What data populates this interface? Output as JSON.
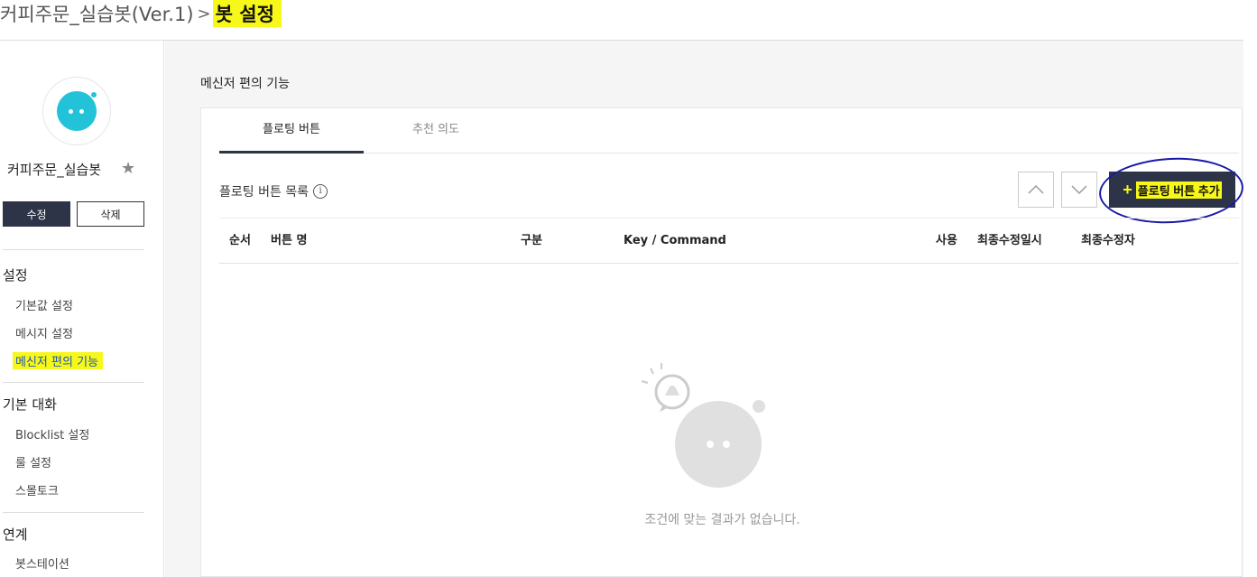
{
  "breadcrumb": {
    "parent": "커피주문_실습봇(Ver.1)",
    "separator": ">",
    "current": "봇 설정"
  },
  "sidebar": {
    "bot_name": "커피주문_실습봇",
    "edit_label": "수정",
    "delete_label": "삭제",
    "sections": [
      {
        "title": "설정",
        "items": [
          "기본값 설정",
          "메시지 설정",
          "메신저 편의 기능"
        ]
      },
      {
        "title": "기본 대화",
        "items": [
          "Blocklist 설정",
          "룰 설정",
          "스몰토크"
        ]
      },
      {
        "title": "연계",
        "items": [
          "봇스테이션"
        ]
      }
    ],
    "active_item": "메신저 편의 기능"
  },
  "main": {
    "title": "메신저 편의 기능",
    "tabs": [
      "플로팅 버튼",
      "추천 의도"
    ],
    "active_tab": 0,
    "list_title": "플로팅 버튼 목록",
    "info_icon": "i",
    "add_button_label": "플로팅 버튼 추가",
    "add_button_icon": "+",
    "columns": [
      "순서",
      "버튼 명",
      "구분",
      "Key / Command",
      "사용",
      "최종수정일시",
      "최종수정자"
    ],
    "empty_message": "조건에 맞는 결과가 없습니다."
  },
  "colors": {
    "accent": "#2d3447",
    "bot_cyan": "#22c3d9",
    "highlight": "#f7f71a",
    "annotation_blue": "#1a1aa8"
  }
}
